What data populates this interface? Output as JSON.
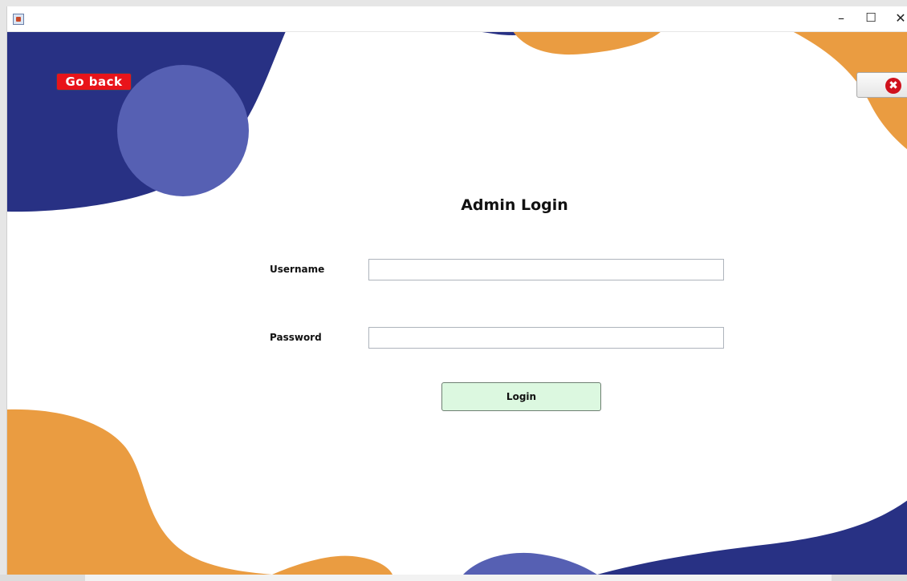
{
  "window": {
    "title": "",
    "controls": {
      "minimize": "–",
      "maximize": "☐",
      "close": "✕"
    }
  },
  "header": {
    "go_back_label": "Go back",
    "exit_icon": "close-circle-icon",
    "exit_glyph": "✖"
  },
  "form": {
    "title": "Admin Login",
    "username_label": "Username",
    "username_value": "",
    "password_label": "Password",
    "password_value": "",
    "login_label": "Login"
  },
  "colors": {
    "navy": "#283184",
    "periwinkle": "#5660b3",
    "orange": "#ea9c41",
    "go_back_red": "#e8141a",
    "login_green": "#dcf8e0"
  }
}
